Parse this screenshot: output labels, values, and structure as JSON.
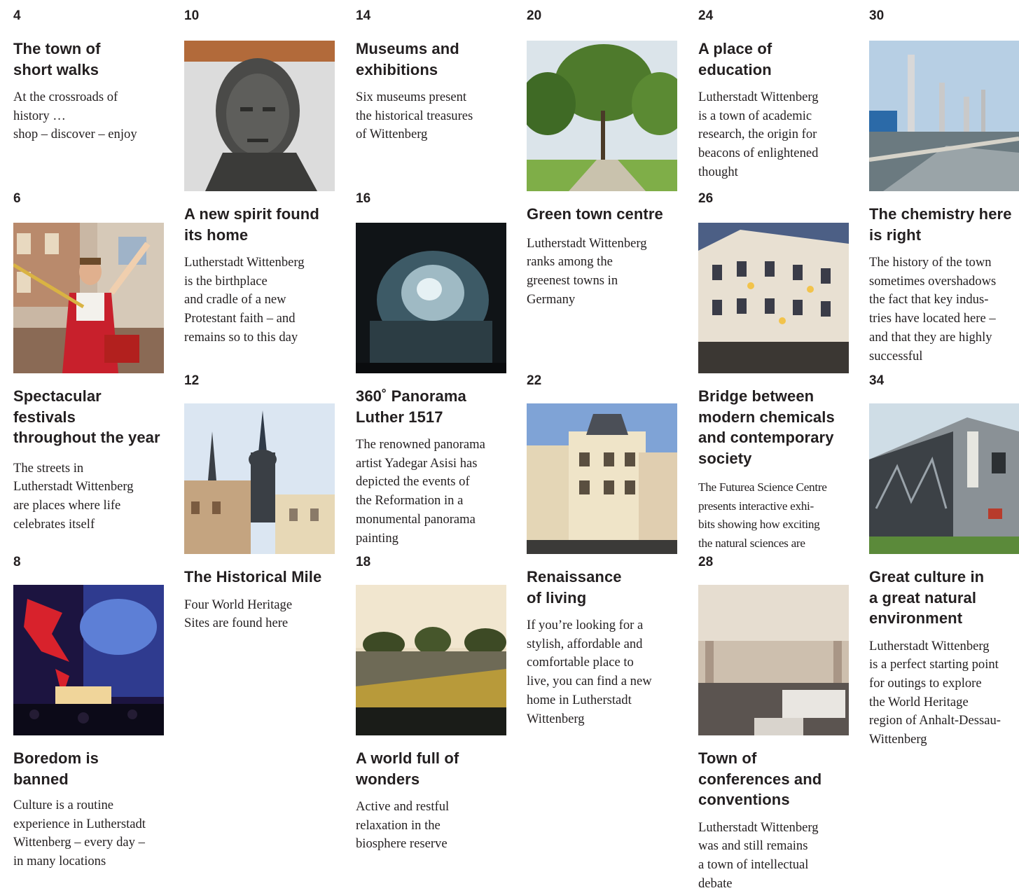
{
  "entries": [
    {
      "page": "4",
      "title": "The town of\nshort walks",
      "desc": "At the crossroads of\nhistory …\nshop – discover – enjoy"
    },
    {
      "page": "6",
      "title": "Spectacular\nfestivals\nthroughout the year",
      "desc": "The streets in\nLutherstadt Wittenberg\nare places where life\ncelebrates itself"
    },
    {
      "page": "8",
      "title": "Boredom is\nbanned",
      "desc": "Culture is a routine\nexperience in Lutherstadt\nWittenberg – every day –\nin many locations"
    },
    {
      "page": "10",
      "title": "A new spirit found\nits home",
      "desc": "Lutherstadt Wittenberg\nis the birthplace\nand cradle of a new\nProtestant faith – and\nremains so to this day"
    },
    {
      "page": "12",
      "title": "The Historical Mile",
      "desc": "Four World Heritage\nSites are found here"
    },
    {
      "page": "14",
      "title": "Museums and\nexhibitions",
      "desc": "Six museums present\nthe historical treasures\nof Wittenberg"
    },
    {
      "page": "16",
      "title": "360˚ Panorama\nLuther 1517",
      "desc": "The renowned panorama\nartist Yadegar Asisi has\ndepicted the events of\nthe Reformation in a\nmonumental panorama\npainting"
    },
    {
      "page": "18",
      "title": "A world full of\nwonders",
      "desc": "Active and restful\nrelaxation in the\nbiosphere reserve"
    },
    {
      "page": "20",
      "title": "Green town centre",
      "desc": "Lutherstadt Wittenberg\nranks among the\ngreenest towns in\nGermany"
    },
    {
      "page": "22",
      "title": "Renaissance\nof living",
      "desc": "If you’re looking for a\nstylish, affordable and\ncomfortable place to\nlive, you can find a new\nhome in Lutherstadt\nWittenberg"
    },
    {
      "page": "24",
      "title": "A place of\neducation",
      "desc": "Lutherstadt Wittenberg\nis a town of academic\nresearch, the origin for\nbeacons of enlightened\nthought"
    },
    {
      "page": "26",
      "title": "Bridge between\nmodern chemicals\nand contemporary\nsociety",
      "desc": "The Futurea Science Centre\npresents interactive exhi-\nbits showing how exciting\nthe natural sciences are"
    },
    {
      "page": "28",
      "title": "Town of\nconferences and\nconventions",
      "desc": "Lutherstadt Wittenberg\nwas and still remains\na town of intellectual\ndebate"
    },
    {
      "page": "30",
      "title": "The chemistry here\nis right",
      "desc": "The history of the town\nsometimes overshadows\nthe fact that key indus-\ntries have located here –\nand that they are highly\nsuccessful"
    },
    {
      "page": "34",
      "title": "Great culture in\na great natural\nenvironment",
      "desc": "Lutherstadt Wittenberg\nis a perfect starting point\nfor outings to explore\nthe World Heritage\nregion of Anhalt-Dessau-\nWittenberg"
    }
  ],
  "colors": {
    "text": "#231f20",
    "background": "#ffffff"
  }
}
